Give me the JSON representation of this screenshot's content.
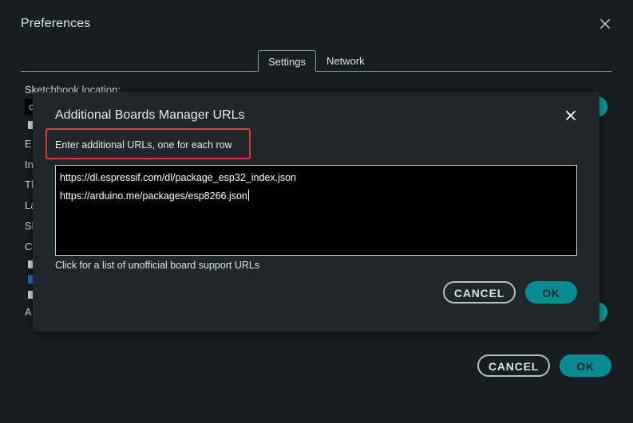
{
  "preferences": {
    "title": "Preferences",
    "tabs": [
      {
        "label": "Settings",
        "active": true
      },
      {
        "label": "Network",
        "active": false
      }
    ],
    "sketchbook_label": "Sketchbook location:",
    "input_stub": "c",
    "fragments": [
      "E",
      "In",
      "Th",
      "La",
      "Sh",
      "C",
      "A"
    ],
    "buttons": {
      "cancel": "CANCEL",
      "ok": "OK"
    }
  },
  "dialog": {
    "title": "Additional Boards Manager URLs",
    "hint": "Enter additional URLs, one for each row",
    "urls": [
      "https://dl.espressif.com/dl/package_esp32_index.json",
      "https://arduino.me/packages/esp8266.json"
    ],
    "link_text": "Click for a list of unofficial board support URLs",
    "buttons": {
      "cancel": "CANCEL",
      "ok": "OK"
    }
  },
  "icons": {
    "close": "close-icon"
  },
  "colors": {
    "background": "#171e21",
    "dialog_background": "#1f272a",
    "accent_teal": "#0a8b91",
    "highlight_red": "#e53935"
  }
}
